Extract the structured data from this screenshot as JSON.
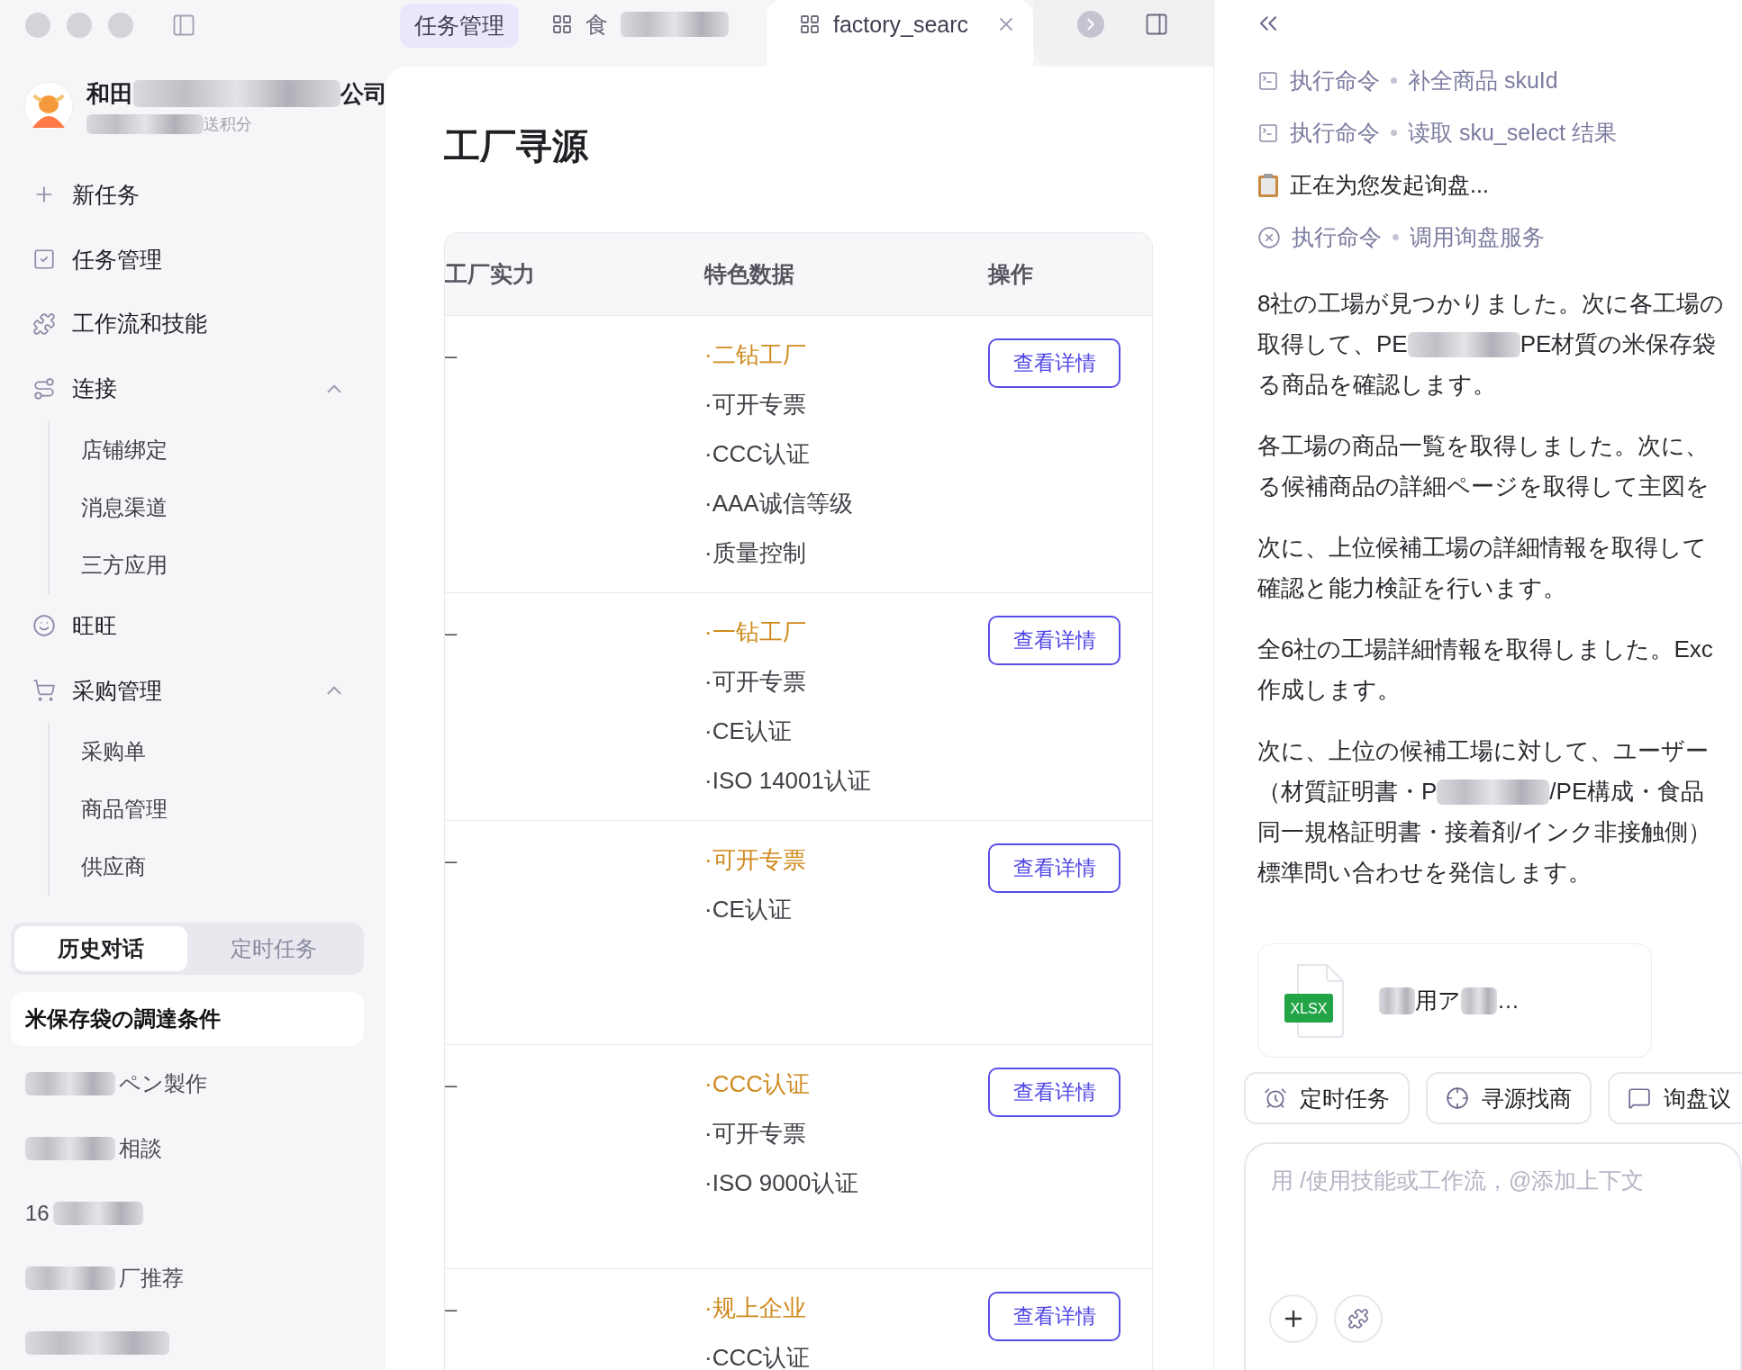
{
  "profile": {
    "name": [
      {
        "kind": "text",
        "text": "和田"
      },
      {
        "kind": "redacted"
      },
      {
        "kind": "text",
        "text": "公司"
      }
    ],
    "subtitle": [
      {
        "kind": "redacted"
      },
      {
        "kind": "text",
        "text": "送积分"
      }
    ]
  },
  "nav": [
    {
      "label": "新任务"
    },
    {
      "label": "任务管理"
    },
    {
      "label": "工作流和技能"
    },
    {
      "label": "连接",
      "expanded": true,
      "children": [
        {
          "label": "店铺绑定"
        },
        {
          "label": "消息渠道"
        },
        {
          "label": "三方应用"
        }
      ]
    },
    {
      "label": "旺旺"
    },
    {
      "label": "采购管理",
      "expanded": true,
      "children": [
        {
          "label": "采购单"
        },
        {
          "label": "商品管理"
        },
        {
          "label": "供应商"
        }
      ]
    }
  ],
  "history_tabs": [
    {
      "label": "历史对话",
      "selected": true
    },
    {
      "label": "定时任务",
      "selected": false
    }
  ],
  "history": [
    {
      "selected": true,
      "segments": [
        {
          "kind": "text",
          "text": "米保存袋の調達条件"
        }
      ]
    },
    {
      "selected": false,
      "segments": [
        {
          "kind": "redacted"
        },
        {
          "kind": "text",
          "text": "ペン製作"
        }
      ]
    },
    {
      "selected": false,
      "segments": [
        {
          "kind": "redacted"
        },
        {
          "kind": "text",
          "text": "相談"
        }
      ]
    },
    {
      "selected": false,
      "segments": [
        {
          "kind": "text",
          "text": "16"
        },
        {
          "kind": "redacted"
        }
      ]
    },
    {
      "selected": false,
      "segments": [
        {
          "kind": "redacted"
        },
        {
          "kind": "text",
          "text": "厂推荐"
        }
      ]
    },
    {
      "selected": false,
      "segments": [
        {
          "kind": "redacted"
        }
      ]
    }
  ],
  "module": {
    "label": "任务管理",
    "selected": true
  },
  "tabs": [
    {
      "selected": false,
      "segments": [
        {
          "kind": "text",
          "text": "食"
        },
        {
          "kind": "redacted"
        }
      ]
    },
    {
      "selected": true,
      "segments": [
        {
          "kind": "text",
          "text": "factory_searc"
        }
      ]
    }
  ],
  "main": {
    "title": "工厂寻源",
    "table": {
      "columns": [
        "工厂实力",
        "特色数据",
        "操作"
      ],
      "rows": [
        {
          "strength": "–",
          "action": "查看详情",
          "features": [
            {
              "text": "·二钻工厂",
              "highlight": true
            },
            {
              "text": "·可开专票",
              "highlight": false
            },
            {
              "text": "·CCC认证",
              "highlight": false
            },
            {
              "text": "·AAA诚信等级",
              "highlight": false
            },
            {
              "text": "·质量控制",
              "highlight": false
            }
          ]
        },
        {
          "strength": "–",
          "action": "查看详情",
          "features": [
            {
              "text": "·一钻工厂",
              "highlight": true
            },
            {
              "text": "·可开专票",
              "highlight": false
            },
            {
              "text": "·CE认证",
              "highlight": false
            },
            {
              "text": "·ISO 14001认证",
              "highlight": false
            }
          ]
        },
        {
          "strength": "–",
          "action": "查看详情",
          "features": [
            {
              "text": "·可开专票",
              "highlight": true
            },
            {
              "text": "·CE认证",
              "highlight": false
            }
          ]
        },
        {
          "strength": "–",
          "action": "查看详情",
          "features": [
            {
              "text": "·CCC认证",
              "highlight": true
            },
            {
              "text": "·可开专票",
              "highlight": false
            },
            {
              "text": "·ISO 9000认证",
              "highlight": false
            }
          ]
        },
        {
          "strength": "–",
          "action": "查看详情",
          "features": [
            {
              "text": "·规上企业",
              "highlight": true
            },
            {
              "text": "·CCC认证",
              "highlight": false
            }
          ]
        }
      ]
    }
  },
  "chat": {
    "steps": [
      {
        "kind": "command",
        "label": "执行命令",
        "detail": "补全商品 skuId"
      },
      {
        "kind": "command",
        "label": "执行命令",
        "detail": "读取 sku_select 结果"
      },
      {
        "kind": "status",
        "label": "正在为您发起询盘..."
      },
      {
        "kind": "error",
        "label": "执行命令",
        "detail": "调用询盘服务"
      }
    ],
    "paragraphs": [
      {
        "lines": [
          [
            {
              "kind": "text",
              "text": "8社の工場が見つかりました。次に各工場の"
            }
          ],
          [
            {
              "kind": "text",
              "text": "取得して、PE"
            },
            {
              "kind": "redacted"
            },
            {
              "kind": "text",
              "text": "PE材質の米保存袋"
            }
          ],
          [
            {
              "kind": "text",
              "text": "る商品を確認します。"
            }
          ]
        ]
      },
      {
        "lines": [
          [
            {
              "kind": "text",
              "text": "各工場の商品一覧を取得しました。次に、"
            }
          ],
          [
            {
              "kind": "text",
              "text": "る候補商品の詳細ページを取得して主図を"
            }
          ]
        ]
      },
      {
        "lines": [
          [
            {
              "kind": "text",
              "text": "次に、上位候補工場の詳細情報を取得して"
            }
          ],
          [
            {
              "kind": "text",
              "text": "確認と能力検証を行います。"
            }
          ]
        ]
      },
      {
        "lines": [
          [
            {
              "kind": "text",
              "text": "全6社の工場詳細情報を取得しました。Exc"
            }
          ],
          [
            {
              "kind": "text",
              "text": "作成します。"
            }
          ]
        ]
      },
      {
        "lines": [
          [
            {
              "kind": "text",
              "text": "次に、上位の候補工場に対して、ユーザー"
            }
          ],
          [
            {
              "kind": "text",
              "text": "（材質証明書・P"
            },
            {
              "kind": "redacted"
            },
            {
              "kind": "text",
              "text": "/PE構成・食品"
            }
          ],
          [
            {
              "kind": "text",
              "text": "同一規格証明書・接着剤/インク非接触側）"
            }
          ],
          [
            {
              "kind": "text",
              "text": "標準問い合わせを発信します。"
            }
          ]
        ]
      }
    ],
    "file": {
      "badge": "XLSX",
      "name": [
        {
          "kind": "redacted"
        },
        {
          "kind": "text",
          "text": "用ア"
        },
        {
          "kind": "redacted"
        },
        {
          "kind": "text",
          "text": "…"
        }
      ]
    },
    "chips": [
      "定时任务",
      "寻源找商",
      "询盘议"
    ],
    "composer": {
      "placeholder": "用 /使用技能或工作流，@添加上下文"
    }
  }
}
